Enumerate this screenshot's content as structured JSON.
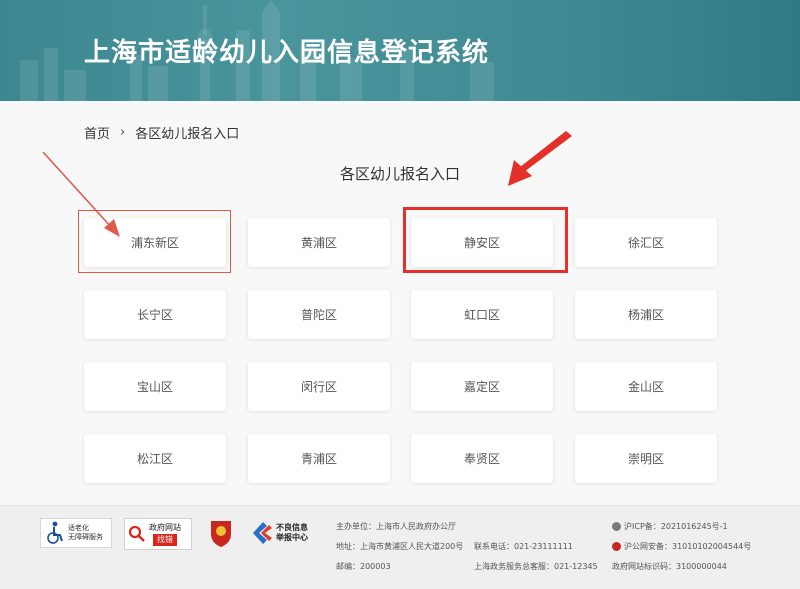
{
  "header": {
    "title": "上海市适龄幼儿入园信息登记系统"
  },
  "breadcrumb": {
    "home": "首页",
    "separator": "›",
    "current": "各区幼儿报名入口"
  },
  "section_title": "各区幼儿报名入口",
  "districts": [
    "浦东新区",
    "黄浦区",
    "静安区",
    "徐汇区",
    "长宁区",
    "普陀区",
    "虹口区",
    "杨浦区",
    "宝山区",
    "闵行区",
    "嘉定区",
    "金山区",
    "松江区",
    "青浦区",
    "奉贤区",
    "崇明区"
  ],
  "footer": {
    "logo_accessibility": [
      "适老化",
      "无障碍服务"
    ],
    "logo_gov_site": [
      "政府网站",
      "找错"
    ],
    "logo_report": [
      "不良信息",
      "举报中心"
    ],
    "host_label": "主办单位",
    "host": "主办单位：上海市人民政府办公厅",
    "address": "地址：上海市黄浦区人民大道200号",
    "zip": "邮编：200003",
    "phone": "联系电话：021-23111111",
    "service_phone": "上海政务服务总客服：021-12345",
    "icp": "沪ICP备：2021016245号-1",
    "police": "沪公网安备：31010102004544号",
    "site_code": "政府网站标识码：3100000044"
  },
  "colors": {
    "header_bg": "#3f8a93",
    "highlight_red": "#e4302a",
    "page_bg": "#f8f8f8"
  }
}
